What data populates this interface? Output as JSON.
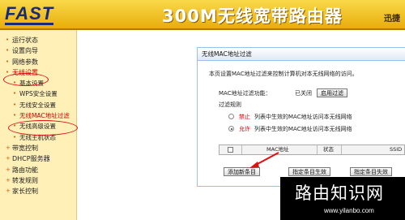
{
  "header": {
    "logo": "FAST",
    "product_title": "300M无线宽带路由器",
    "brand_right": "迅捷"
  },
  "sidebar": {
    "items": [
      {
        "label": "运行状态"
      },
      {
        "label": "设置向导"
      },
      {
        "label": "网络参数"
      },
      {
        "label": "无线设置"
      },
      {
        "label": "基本设置"
      },
      {
        "label": "WPS安全设置"
      },
      {
        "label": "无线安全设置"
      },
      {
        "label": "无线MAC地址过滤"
      },
      {
        "label": "无线高级设置"
      },
      {
        "label": "无线主机状态"
      },
      {
        "label": "带宽控制"
      },
      {
        "label": "DHCP服务器"
      },
      {
        "label": "路由功能"
      },
      {
        "label": "转发规则"
      },
      {
        "label": "家长控制"
      }
    ]
  },
  "panel": {
    "title": "无线MAC地址过滤",
    "description": "本页设置MAC地址过滤来控制计算机对本无线网络的访问。",
    "filter_status_label": "MAC地址过滤功能：",
    "filter_status_value": "已关闭",
    "enable_button": "启用过滤",
    "rules_label": "过滤规则",
    "rule_deny_keyword": "禁止",
    "rule_deny_text": "列表中生效的MAC地址访问本无线网络",
    "rule_allow_keyword": "允许",
    "rule_allow_text": "列表中生效的MAC地址访问本无线网络",
    "table_headers": {
      "mac": "MAC地址",
      "status": "状态",
      "ssid": "SSID"
    },
    "buttons": {
      "add": "添加新条目",
      "enable_all": "指定条目生效",
      "disable_all": "指定条目失效"
    }
  },
  "watermark": {
    "title": "路由知识网",
    "url": "www.yilanbo.com"
  },
  "colors": {
    "header": "#f0c020",
    "sidebar": "#fff0b8",
    "highlight": "#e01010"
  }
}
